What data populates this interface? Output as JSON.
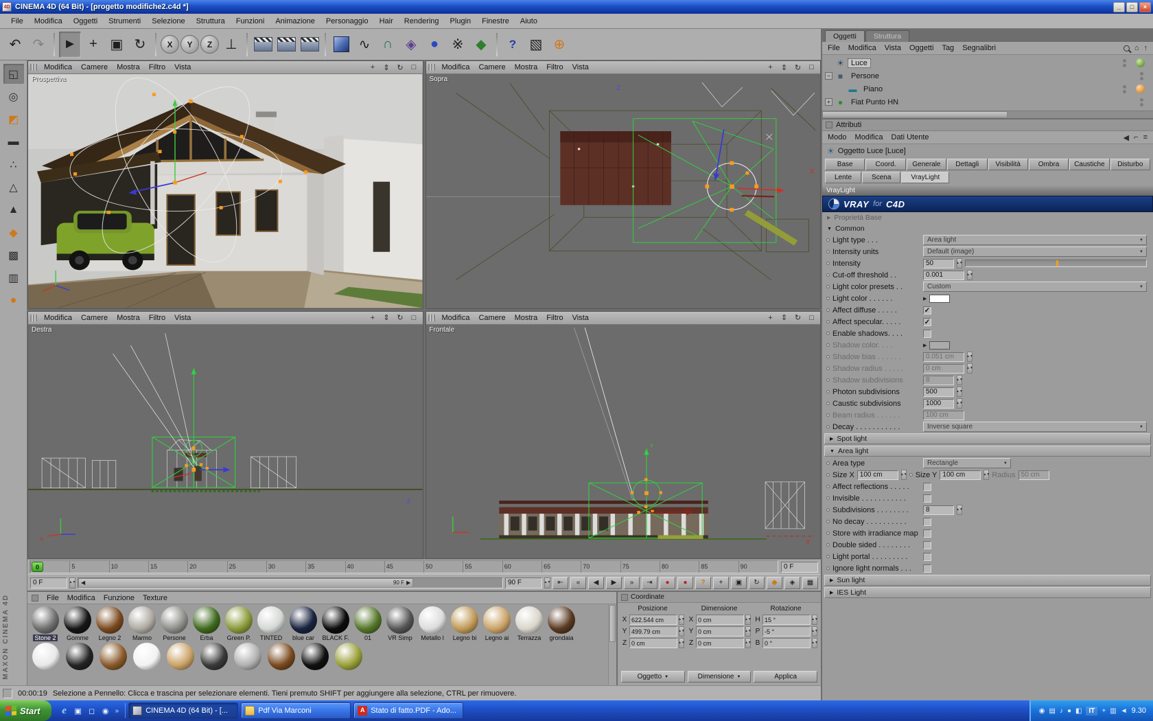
{
  "window": {
    "title": "CINEMA 4D (64 Bit) - [progetto modifiche2.c4d *]",
    "minimize": "_",
    "maximize": "□",
    "close": "×"
  },
  "menu_bar": [
    "File",
    "Modifica",
    "Oggetti",
    "Strumenti",
    "Selezione",
    "Struttura",
    "Funzioni",
    "Animazione",
    "Personaggio",
    "Hair",
    "Rendering",
    "Plugin",
    "Finestre",
    "Aiuto"
  ],
  "toolbar": {
    "items": [
      {
        "name": "undo",
        "glyph": "↶"
      },
      {
        "name": "redo",
        "glyph": "↷"
      },
      {
        "name": "live-selection",
        "glyph": "►"
      },
      {
        "name": "move",
        "glyph": "+"
      },
      {
        "name": "scale",
        "glyph": "▣"
      },
      {
        "name": "rotate",
        "glyph": "↻"
      },
      {
        "name": "lock-x-axis",
        "glyph": "X"
      },
      {
        "name": "lock-y-axis",
        "glyph": "Y"
      },
      {
        "name": "lock-z-axis",
        "glyph": "Z"
      },
      {
        "name": "coordinate-system",
        "glyph": "⊥"
      },
      {
        "name": "render-view",
        "glyph": ""
      },
      {
        "name": "render-region",
        "glyph": ""
      },
      {
        "name": "render-settings",
        "glyph": ""
      },
      {
        "name": "add-primitive",
        "glyph": ""
      },
      {
        "name": "add-spline",
        "glyph": "∿"
      },
      {
        "name": "add-nurbs",
        "glyph": "∩"
      },
      {
        "name": "add-modeling-object",
        "glyph": "◈"
      },
      {
        "name": "add-scene-object",
        "glyph": "●"
      },
      {
        "name": "add-particle-object",
        "glyph": "※"
      },
      {
        "name": "add-deformer",
        "glyph": "◆"
      },
      {
        "name": "help",
        "glyph": "?"
      },
      {
        "name": "layout",
        "glyph": "▧"
      },
      {
        "name": "online-updater",
        "glyph": "⊕"
      }
    ]
  },
  "left_tools": {
    "brand": "MAXON CINEMA 4D",
    "items": [
      {
        "name": "make-editable",
        "glyph": "◱"
      },
      {
        "name": "model-mode",
        "glyph": "◎"
      },
      {
        "name": "texture-mode",
        "glyph": "◩"
      },
      {
        "name": "workplane-mode",
        "glyph": "▬"
      },
      {
        "name": "point-mode",
        "glyph": "∴"
      },
      {
        "name": "edge-mode",
        "glyph": "△"
      },
      {
        "name": "polygon-mode",
        "glyph": "▲"
      },
      {
        "name": "axis-mode",
        "glyph": "◆"
      },
      {
        "name": "texture-axis-mode",
        "glyph": "▩"
      },
      {
        "name": "uv-mode",
        "glyph": "▥"
      },
      {
        "name": "snap-settings",
        "glyph": "●"
      }
    ]
  },
  "viewports": {
    "menus": [
      "Modifica",
      "Camere",
      "Mostra",
      "Filtro",
      "Vista"
    ],
    "tools": [
      {
        "name": "pan-view",
        "glyph": "+"
      },
      {
        "name": "zoom-view",
        "glyph": "⇕"
      },
      {
        "name": "rotate-view",
        "glyph": "↻"
      },
      {
        "name": "maximize-view",
        "glyph": "□"
      }
    ],
    "labels": {
      "perspective": "Prospettiva",
      "top": "Sopra",
      "right": "Destra",
      "front": "Frontale"
    },
    "axis": {
      "x": "X",
      "y": "Y",
      "z": "Z"
    }
  },
  "timeline": {
    "ticks": [
      "0",
      "5",
      "10",
      "15",
      "20",
      "25",
      "30",
      "35",
      "40",
      "45",
      "50",
      "55",
      "60",
      "65",
      "70",
      "75",
      "80",
      "85",
      "90"
    ],
    "marker": "0",
    "ruler_frame": "0 F",
    "current": "0 F",
    "range_end": "90 F",
    "end": "90 F",
    "transport": [
      {
        "name": "goto-start",
        "glyph": "⇤"
      },
      {
        "name": "previous-key",
        "glyph": "«"
      },
      {
        "name": "previous-frame",
        "glyph": "◀"
      },
      {
        "name": "play",
        "glyph": "▶"
      },
      {
        "name": "next-frame",
        "glyph": "»"
      },
      {
        "name": "goto-end",
        "glyph": "⇥"
      }
    ],
    "record": [
      {
        "name": "record-keyframe",
        "glyph": "●"
      },
      {
        "name": "autokey",
        "glyph": "●"
      },
      {
        "name": "record-help",
        "glyph": "?"
      }
    ],
    "toggles": [
      {
        "name": "record-position",
        "glyph": "+"
      },
      {
        "name": "record-scale",
        "glyph": "▣"
      },
      {
        "name": "record-rotation",
        "glyph": "↻"
      },
      {
        "name": "record-parameter",
        "glyph": "◆"
      },
      {
        "name": "record-pla",
        "glyph": "◈"
      },
      {
        "name": "keyframe-selection",
        "glyph": "▦"
      }
    ]
  },
  "materials": {
    "menus": [
      "File",
      "Modifica",
      "Funzione",
      "Texture"
    ],
    "items": [
      {
        "name": "Stone 2",
        "color": "#6e6e6e"
      },
      {
        "name": "Gomme",
        "color": "#161616"
      },
      {
        "name": "Legno 2",
        "color": "#7a4a20"
      },
      {
        "name": "Marmo",
        "color": "#aeaaa2"
      },
      {
        "name": "Persone",
        "color": "#8e8e8a"
      },
      {
        "name": "Erba",
        "color": "#3f6a1e"
      },
      {
        "name": "Green P.",
        "color": "#8a9a3a"
      },
      {
        "name": "TINTED",
        "color": "#d4d8d4"
      },
      {
        "name": "blue car",
        "color": "#1a2440"
      },
      {
        "name": "BLACK F.",
        "color": "#0c0c0c"
      },
      {
        "name": "01",
        "color": "#55762a"
      },
      {
        "name": "VR Simp",
        "color": "#565656"
      },
      {
        "name": "Metallo l",
        "color": "#dcdcdc"
      },
      {
        "name": "Legno bi",
        "color": "#c09a58"
      },
      {
        "name": "Legno ai",
        "color": "#caa368"
      },
      {
        "name": "Terrazza",
        "color": "#d9d5cb"
      },
      {
        "name": "grondaia",
        "color": "#5a3a22"
      }
    ],
    "row2_colors": [
      "#e8e8e8",
      "#242424",
      "#8a5a2a",
      "#f2f2f2",
      "#caa368",
      "#3a3a3a",
      "#b0b0b0",
      "#7a4a20",
      "#101010",
      "#9aa03a"
    ]
  },
  "coordinates": {
    "title": "Coordinate",
    "groups": [
      "Posizione",
      "Dimensione",
      "Rotazione"
    ],
    "rows": [
      {
        "pl": "X",
        "pv": "622.544 cm",
        "dl": "X",
        "dv": "0 cm",
        "rl": "H",
        "rv": "15 °"
      },
      {
        "pl": "Y",
        "pv": "499.79 cm",
        "dl": "Y",
        "dv": "0 cm",
        "rl": "P",
        "rv": "-5 °"
      },
      {
        "pl": "Z",
        "pv": "0 cm",
        "dl": "Z",
        "dv": "0 cm",
        "rl": "B",
        "rv": "0 °"
      }
    ],
    "buttons": {
      "object": "Oggetto",
      "dimension": "Dimensione",
      "apply": "Applica"
    }
  },
  "object_manager": {
    "tabs": {
      "active": "Oggetti",
      "inactive": "Struttura"
    },
    "menus": [
      "File",
      "Modifica",
      "Vista",
      "Oggetti",
      "Tag",
      "Segnalibri"
    ],
    "objects": [
      {
        "name": "Luce",
        "icon": "☀",
        "expander": ""
      },
      {
        "name": "Persone",
        "icon": "■",
        "expander": "−"
      },
      {
        "name": "Piano",
        "icon": "▬",
        "expander": ""
      },
      {
        "name": "Fiat  Punto  HN",
        "icon": "●",
        "expander": "+"
      }
    ]
  },
  "attributes": {
    "title": "Attributi",
    "menus": [
      "Modo",
      "Modifica",
      "Dati Utente"
    ],
    "object_title": "Oggetto Luce [Luce]",
    "tabs1": [
      "Base",
      "Coord.",
      "Generale",
      "Dettagli",
      "Visibilità",
      "Ombra",
      "Caustiche",
      "Disturbo"
    ],
    "tabs2": [
      "Lente",
      "Scena",
      "VrayLight"
    ],
    "section": "VrayLight",
    "logo": {
      "vray": "VRAY",
      "fortext": "for",
      "c4d": "C4D"
    },
    "groups": {
      "base": "Proprietà Base",
      "common": "Common",
      "spot": "Spot light",
      "area": "Area light",
      "sun": "Sun light",
      "ies": "IES Light"
    },
    "fields": {
      "light_type": {
        "label": "Light type . . .",
        "value": "Area light"
      },
      "intensity_units": {
        "label": "Intensity units",
        "value": "Default (image)"
      },
      "intensity": {
        "label": "Intensity",
        "value": "50"
      },
      "cutoff": {
        "label": "Cut-off threshold . .",
        "value": "0.001"
      },
      "presets": {
        "label": "Light color presets . .",
        "value": "Custom"
      },
      "light_color": {
        "label": "Light color . . . . . ."
      },
      "affect_diffuse": {
        "label": "Affect diffuse . . . . ."
      },
      "affect_specular": {
        "label": "Affect specular. . . . ."
      },
      "enable_shadows": {
        "label": "Enable shadows. . . ."
      },
      "shadow_color": {
        "label": "Shadow color. . . ."
      },
      "shadow_bias": {
        "label": "Shadow bias . . . . . .",
        "value": "0.051 cm"
      },
      "shadow_radius": {
        "label": "Shadow radius . . . . .",
        "value": "0 cm"
      },
      "shadow_subdivisions": {
        "label": "Shadow subdivisions",
        "value": "8"
      },
      "photon_subdivisions": {
        "label": "Photon subdivisions",
        "value": "500"
      },
      "caustic_subdivisions": {
        "label": "Caustic subdivisions",
        "value": "1000"
      },
      "beam_radius": {
        "label": "Beam radius . . . . . .",
        "value": "100 cm"
      },
      "decay": {
        "label": "Decay . . . . . . . . . . .",
        "value": "Inverse square"
      },
      "area_type": {
        "label": "Area type",
        "value": "Rectangle"
      },
      "size_x": {
        "label": "Size X",
        "value": "100 cm"
      },
      "size_y": {
        "label": "Size Y",
        "value": "100 cm"
      },
      "radius": {
        "label": "Radius",
        "value": "50 cm"
      },
      "affect_reflections": {
        "label": "Affect reflections . . . . ."
      },
      "invisible": {
        "label": "Invisible . . . . . . . . . . ."
      },
      "subdivisions": {
        "label": "Subdivisions . . . . . . . .",
        "value": "8"
      },
      "no_decay": {
        "label": "No decay . . . . . . . . . ."
      },
      "store_irradiance": {
        "label": "Store with irradiance map"
      },
      "double_sided": {
        "label": "Double sided . . . . . . . ."
      },
      "light_portal": {
        "label": "Light portal . . . . . . . . ."
      },
      "ignore_normals": {
        "label": "Ignore light normals . . ."
      }
    }
  },
  "status_bar": {
    "time": "00:00:19",
    "message": "Selezione a Pennello: Clicca e trascina per selezionare elementi. Tieni premuto SHIFT per aggiungere alla selezione, CTRL per rimuovere."
  },
  "taskbar": {
    "start": "Start",
    "quick_launch": [
      "e",
      "▣",
      "◻",
      "◉"
    ],
    "quick_launch_more": "»",
    "tasks": [
      {
        "label": "CINEMA 4D (64 Bit) - [..."
      },
      {
        "label": "Pdf Via Marconi"
      },
      {
        "label": "Stato di fatto.PDF - Ado..."
      }
    ],
    "tray_icons": [
      "◉",
      "▤",
      "♪",
      "●",
      "◧"
    ],
    "tray_lang": "IT",
    "tray_icons2": [
      "+",
      "▥",
      "◄"
    ],
    "clock": "9.30"
  }
}
